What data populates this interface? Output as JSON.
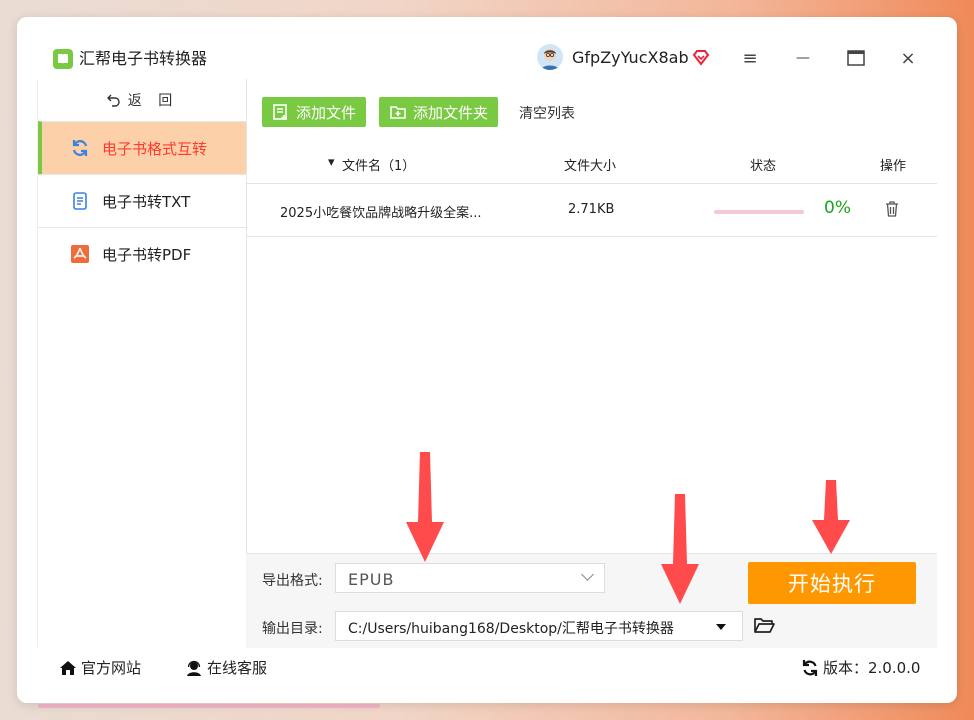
{
  "app": {
    "title": "汇帮电子书转换器",
    "username": "GfpZyYucX8ab"
  },
  "window_controls": {
    "menu": "≡",
    "minimize": "—",
    "maximize": "▭",
    "close": "×"
  },
  "sidebar": {
    "back_label": "返 回",
    "items": [
      {
        "label": "电子书格式互转",
        "icon": "refresh-icon",
        "active": true
      },
      {
        "label": "电子书转TXT",
        "icon": "document-icon",
        "active": false
      },
      {
        "label": "电子书转PDF",
        "icon": "pdf-icon",
        "active": false
      }
    ]
  },
  "toolbar": {
    "add_file": "添加文件",
    "add_folder": "添加文件夹",
    "clear_list": "清空列表"
  },
  "table": {
    "headers": {
      "name": "文件名（1）",
      "size": "文件大小",
      "status": "状态",
      "action": "操作"
    },
    "rows": [
      {
        "name": "2025小吃餐饮品牌战略升级全案...",
        "size": "2.71KB",
        "progress": "0%"
      }
    ]
  },
  "settings": {
    "format_label": "导出格式:",
    "format_value": "EPUB",
    "dir_label": "输出目录:",
    "dir_value": "C:/Users/huibang168/Desktop/汇帮电子书转换器",
    "start_button": "开始执行"
  },
  "footer": {
    "website": "官方网站",
    "support": "在线客服",
    "version": "版本：2.0.0.0"
  },
  "colors": {
    "accent_green": "#7ac943",
    "accent_orange": "#ff9800",
    "active_bg": "#fcd0a8",
    "active_text": "#ff3b2f",
    "arrow_red": "#ff4b4b"
  }
}
